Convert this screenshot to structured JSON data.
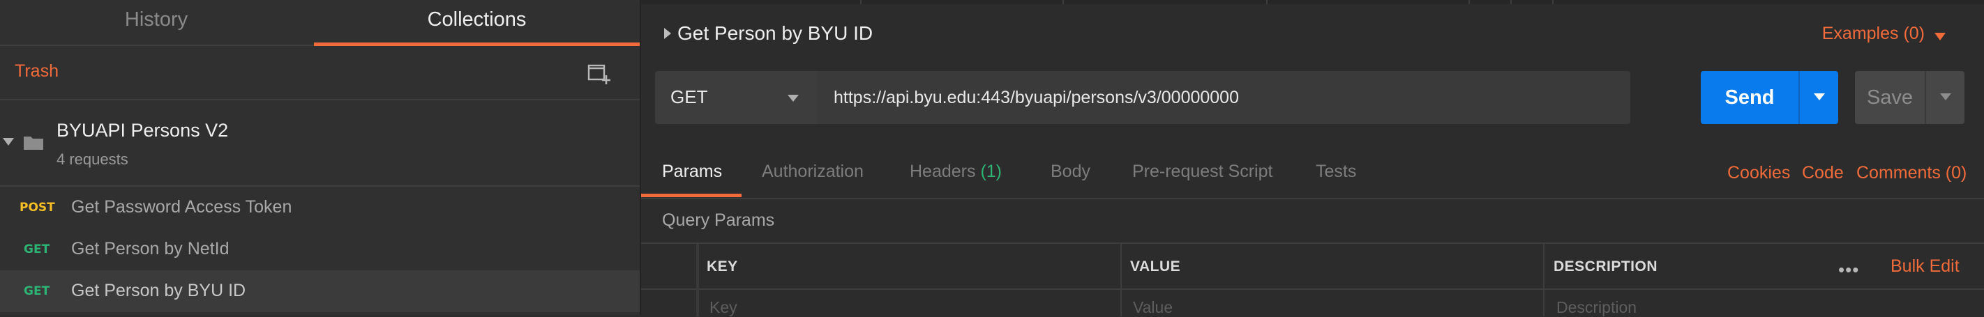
{
  "sidebar": {
    "tabs": {
      "history": "History",
      "collections": "Collections"
    },
    "trash_label": "Trash",
    "collection": {
      "name": "BYUAPI Persons V2",
      "meta": "4 requests"
    },
    "requests": [
      {
        "method": "POST",
        "name": "Get Password Access Token"
      },
      {
        "method": "GET",
        "name": "Get Person by NetId"
      },
      {
        "method": "GET",
        "name": "Get Person by BYU ID"
      }
    ]
  },
  "request": {
    "title": "Get Person by BYU ID",
    "examples_label": "Examples (0)",
    "method": "GET",
    "url": "https://api.byu.edu:443/byuapi/persons/v3/00000000",
    "send_label": "Send",
    "save_label": "Save"
  },
  "request_tabs": {
    "params": "Params",
    "authorization": "Authorization",
    "headers": "Headers",
    "headers_count": "(1)",
    "body": "Body",
    "pre_request": "Pre-request Script",
    "tests": "Tests"
  },
  "links": {
    "cookies": "Cookies",
    "code": "Code",
    "comments": "Comments (0)"
  },
  "query_params": {
    "label": "Query Params",
    "columns": {
      "key": "KEY",
      "value": "VALUE",
      "description": "DESCRIPTION"
    },
    "bulk_edit": "Bulk Edit",
    "placeholders": {
      "key": "Key",
      "value": "Value",
      "description": "Description"
    }
  },
  "colors": {
    "accent": "#f26b3a",
    "send_blue": "#097bed",
    "get_green": "#2cb574",
    "post_yellow": "#f6bf26"
  },
  "icons": {
    "new_collection": "new-collection-icon",
    "folder": "folder-icon",
    "more": "more-dots-icon"
  }
}
